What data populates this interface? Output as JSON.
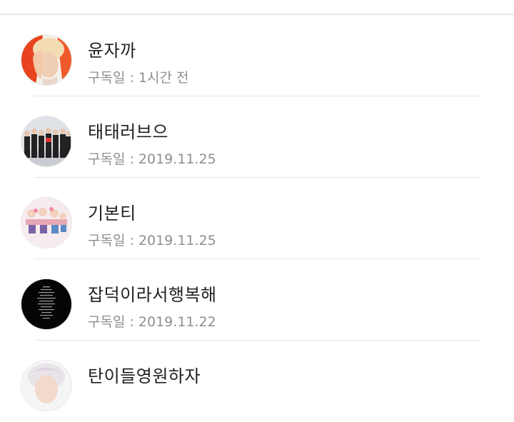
{
  "subscriptions": [
    {
      "name": "윤자까",
      "date_label": "구독일 : ",
      "date_value": "1시간 전",
      "avatar": "avatar-photo"
    },
    {
      "name": "태태러브으",
      "date_label": "구독일 : ",
      "date_value": "2019.11.25",
      "avatar": "avatar-photo"
    },
    {
      "name": "기본티",
      "date_label": "구독일 : ",
      "date_value": "2019.11.25",
      "avatar": "avatar-photo"
    },
    {
      "name": "잡덕이라서행복해",
      "date_label": "구독일 : ",
      "date_value": "2019.11.22",
      "avatar": "avatar-photo"
    },
    {
      "name": "탄이들영원하자",
      "date_label": "",
      "date_value": "",
      "avatar": "avatar-photo"
    }
  ],
  "colors": {
    "name_text": "#1f1f1f",
    "sub_text": "#8f8f8f",
    "divider": "#e6e6e6",
    "header_border": "#e3e9ec"
  }
}
